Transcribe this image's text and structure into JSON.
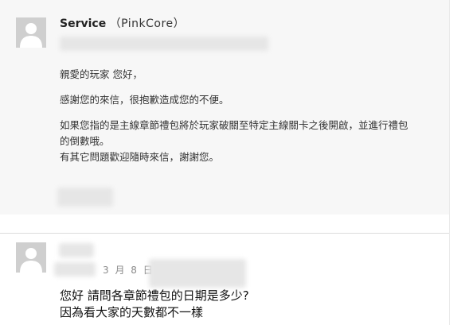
{
  "message1": {
    "sender_name": "Service",
    "sender_org": "（PinkCore）",
    "body": [
      "親愛的玩家 您好，",
      "感謝您的來信，很抱歉造成您的不便。",
      "如果您指的是主線章節禮包將於玩家破關至特定主線關卡之後開啟，並進行禮包",
      "的倒數哦。",
      "有其它問題歡迎隨時來信，謝謝您。"
    ]
  },
  "message2": {
    "date": "3 月 8 日",
    "body": [
      "您好 請問各章節禮包的日期是多少?",
      "因為看大家的天數都不一樣"
    ]
  },
  "icons": {
    "avatar": "default-user-avatar-icon"
  },
  "colors": {
    "message_bg": "#f7f7f7",
    "avatar_bg": "#cfcfcf",
    "date_text": "#8a8a8a"
  }
}
